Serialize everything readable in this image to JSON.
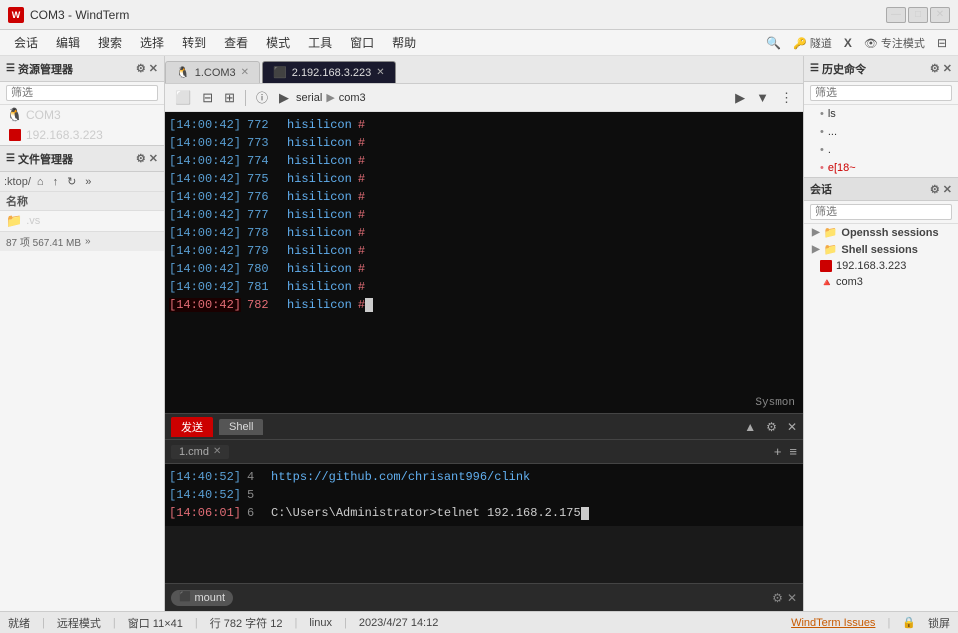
{
  "titleBar": {
    "appIcon": "W",
    "title": "COM3 - WindTerm",
    "winMin": "—",
    "winMax": "□",
    "winClose": "✕"
  },
  "menuBar": {
    "items": [
      "会话",
      "编辑",
      "搜索",
      "选择",
      "转到",
      "查看",
      "模式",
      "工具",
      "窗口",
      "帮助"
    ],
    "rightIcons": [
      "🔍",
      "隧道",
      "X",
      "专注模式",
      "□"
    ]
  },
  "leftPanel": {
    "title": "资源管理器",
    "filterPlaceholder": "筛选",
    "resources": [
      {
        "name": "COM3",
        "type": "linux"
      },
      {
        "name": "192.168.3.223",
        "type": "red"
      }
    ]
  },
  "fileManager": {
    "title": "文件管理器",
    "path": ":ktop/",
    "colName": "名称",
    "files": [
      {
        "name": ".vs",
        "type": "folder"
      }
    ],
    "status": "87 项  567.41 MB"
  },
  "tabs": [
    {
      "id": 1,
      "label": "1.COM3",
      "active": false,
      "icon": "🐧"
    },
    {
      "id": 2,
      "label": "2.192.168.3.223",
      "active": true,
      "icon": "🔴"
    }
  ],
  "toolbar": {
    "pathSerial": "serial",
    "pathCom": "com3"
  },
  "terminal": {
    "lines": [
      {
        "time": "[14:00:42]",
        "num": "772",
        "text": "hisilicon",
        "hash": "#",
        "highlight": false
      },
      {
        "time": "[14:00:42]",
        "num": "773",
        "text": "hisilicon",
        "hash": "#",
        "highlight": false
      },
      {
        "time": "[14:00:42]",
        "num": "774",
        "text": "hisilicon",
        "hash": "#",
        "highlight": false
      },
      {
        "time": "[14:00:42]",
        "num": "775",
        "text": "hisilicon",
        "hash": "#",
        "highlight": false
      },
      {
        "time": "[14:00:42]",
        "num": "776",
        "text": "hisilicon",
        "hash": "#",
        "highlight": false
      },
      {
        "time": "[14:00:42]",
        "num": "777",
        "text": "hisilicon",
        "hash": "#",
        "highlight": false
      },
      {
        "time": "[14:00:42]",
        "num": "778",
        "text": "hisilicon",
        "hash": "#",
        "highlight": false
      },
      {
        "time": "[14:00:42]",
        "num": "779",
        "text": "hisilicon",
        "hash": "#",
        "highlight": false
      },
      {
        "time": "[14:00:42]",
        "num": "780",
        "text": "hisilicon",
        "hash": "#",
        "highlight": false
      },
      {
        "time": "[14:00:42]",
        "num": "781",
        "text": "hisilicon",
        "hash": "#",
        "highlight": false
      },
      {
        "time": "[14:00:42]",
        "num": "782",
        "text": "hisilicon",
        "hash": "#",
        "highlight": true
      }
    ],
    "sysmon": "Sysmon"
  },
  "bottomPanels": {
    "sendTab": "发送",
    "shellTab": "Shell",
    "cmdTabs": [
      {
        "label": "1.cmd",
        "active": true
      }
    ],
    "cmdLines": [
      {
        "time": "[14:40:52]",
        "num": "4",
        "text": "https://github.com/chrisant996/clink",
        "type": "url",
        "err": false
      },
      {
        "time": "[14:40:52]",
        "num": "5",
        "text": "",
        "type": "blank",
        "err": false
      },
      {
        "time": "[14:06:01]",
        "num": "6",
        "text": "C:\\Users\\Administrator>telnet 192.168.2.175",
        "type": "cmd",
        "err": true
      }
    ]
  },
  "tagsBar": {
    "tags": [
      {
        "label": "mount"
      }
    ],
    "rightIcons": [
      "▲",
      "⚙",
      "✕"
    ]
  },
  "rightPanel": {
    "title": "历史命令",
    "filterPlaceholder": "筛选",
    "historyItems": [
      {
        "label": "ls"
      },
      {
        "label": "..."
      },
      {
        "label": "."
      },
      {
        "label": "e[18~",
        "active": true
      }
    ],
    "sessionsTitle": "会话",
    "sessionGroups": [
      {
        "label": "Openssh sessions",
        "expanded": true
      },
      {
        "label": "Shell sessions",
        "expanded": true
      }
    ],
    "sessionItems": [
      {
        "label": "192.168.3.223"
      },
      {
        "label": "com3"
      }
    ]
  },
  "statusBar": {
    "connection": "就绪",
    "mode": "远程模式",
    "window": "窗口 11×41",
    "position": "行 782 字符 12",
    "os": "linux",
    "datetime": "2023/4/27  14:12",
    "link": "WindTerm Issues",
    "lock": "锁屏"
  }
}
